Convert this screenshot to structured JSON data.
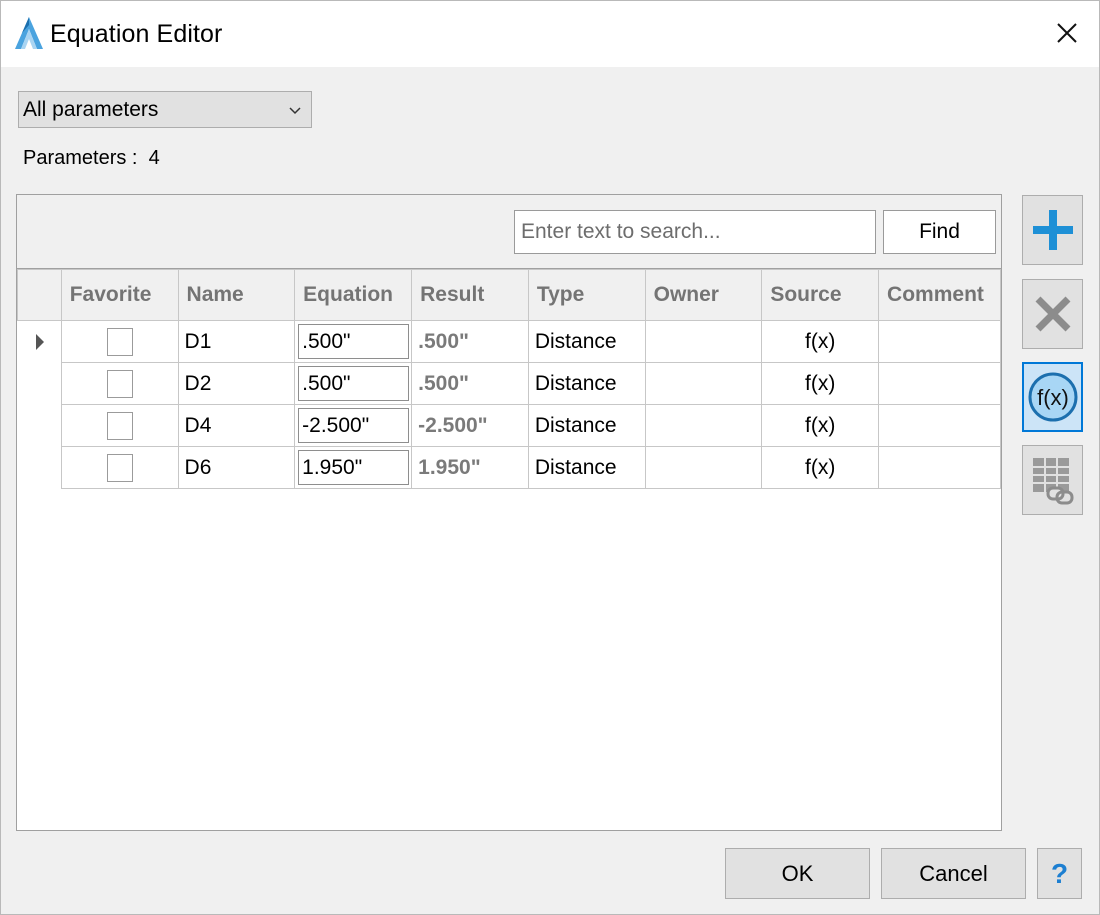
{
  "window": {
    "title": "Equation Editor",
    "accent_color": "#1e90d6"
  },
  "filter": {
    "selected": "All parameters"
  },
  "parameters": {
    "label": "Parameters :",
    "count": "4"
  },
  "search": {
    "placeholder": "Enter text to search...",
    "find_label": "Find"
  },
  "table": {
    "columns": [
      "Favorite",
      "Name",
      "Equation",
      "Result",
      "Type",
      "Owner",
      "Source",
      "Comment"
    ],
    "rows": [
      {
        "favorite": false,
        "name": "D1",
        "equation": ".500\"",
        "result": ".500\"",
        "type": "Distance",
        "owner": "",
        "source": "f(x)",
        "comment": ""
      },
      {
        "favorite": false,
        "name": "D2",
        "equation": ".500\"",
        "result": ".500\"",
        "type": "Distance",
        "owner": "",
        "source": "f(x)",
        "comment": ""
      },
      {
        "favorite": false,
        "name": "D4",
        "equation": "-2.500\"",
        "result": "-2.500\"",
        "type": "Distance",
        "owner": "",
        "source": "f(x)",
        "comment": ""
      },
      {
        "favorite": false,
        "name": "D6",
        "equation": "1.950\"",
        "result": "1.950\"",
        "type": "Distance",
        "owner": "",
        "source": "f(x)",
        "comment": ""
      }
    ]
  },
  "toolbar": {
    "add_icon": "plus-icon",
    "delete_icon": "x-icon",
    "function_icon": "fx-icon",
    "function_label": "f(x)",
    "link_table_icon": "table-link-icon"
  },
  "buttons": {
    "ok": "OK",
    "cancel": "Cancel",
    "help": "?"
  }
}
